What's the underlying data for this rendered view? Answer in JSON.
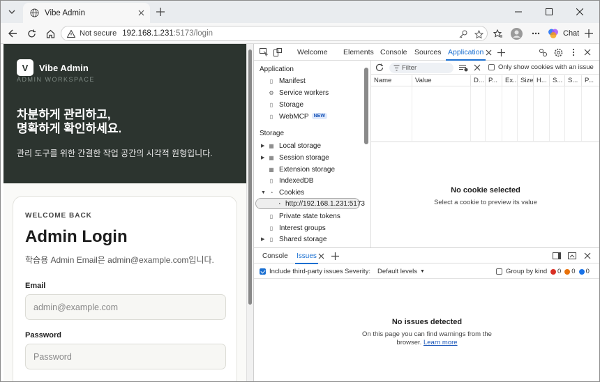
{
  "browser": {
    "tab_title": "Vibe Admin",
    "not_secure": "Not secure",
    "url_host": "192.168.1.231",
    "url_rest": ":5173/login",
    "chat_label": "Chat"
  },
  "page": {
    "logo_letter": "V",
    "brand": "Vibe Admin",
    "brand_sub": "ADMIN WORKSPACE",
    "headline_1": "차분하게 관리하고,",
    "headline_2": "명확하게 확인하세요.",
    "hero_desc": "관리 도구를 위한 간결한 작업 공간의 시각적 원형입니다.",
    "welcome": "WELCOME BACK",
    "title": "Admin Login",
    "desc": "학습용 Admin Email은 admin@example.com입니다.",
    "email_label": "Email",
    "email_placeholder": "admin@example.com",
    "password_label": "Password",
    "password_placeholder": "Password"
  },
  "devtools": {
    "tabs": [
      "Welcome",
      "Elements",
      "Console",
      "Sources",
      "Application"
    ],
    "sidebar": {
      "app_header": "Application",
      "app_items": [
        "Manifest",
        "Service workers",
        "Storage",
        "WebMCP"
      ],
      "new_badge": "NEW",
      "storage_header": "Storage",
      "storage_items": [
        "Local storage",
        "Session storage",
        "Extension storage",
        "IndexedDB",
        "Cookies"
      ],
      "cookie_origin": "http://192.168.1.231:5173",
      "more_items": [
        "Private state tokens",
        "Interest groups",
        "Shared storage"
      ]
    },
    "cookies": {
      "filter_placeholder": "Filter",
      "only_issue": "Only show cookies with an issue",
      "columns": [
        "Name",
        "Value",
        "D...",
        "P...",
        "Ex...",
        "Size",
        "H...",
        "S...",
        "S...",
        "P..."
      ],
      "no_selected": "No cookie selected",
      "no_selected_desc": "Select a cookie to preview its value"
    },
    "drawer": {
      "tabs": [
        "Console",
        "Issues"
      ],
      "include_third_party": "Include third-party issues",
      "severity_label": "Severity:",
      "severity_value": "Default levels",
      "group_by_kind": "Group by kind",
      "counts": [
        "0",
        "0",
        "0"
      ],
      "no_issues": "No issues detected",
      "no_issues_desc": "On this page you can find warnings from the browser.",
      "learn_more": "Learn more"
    }
  }
}
